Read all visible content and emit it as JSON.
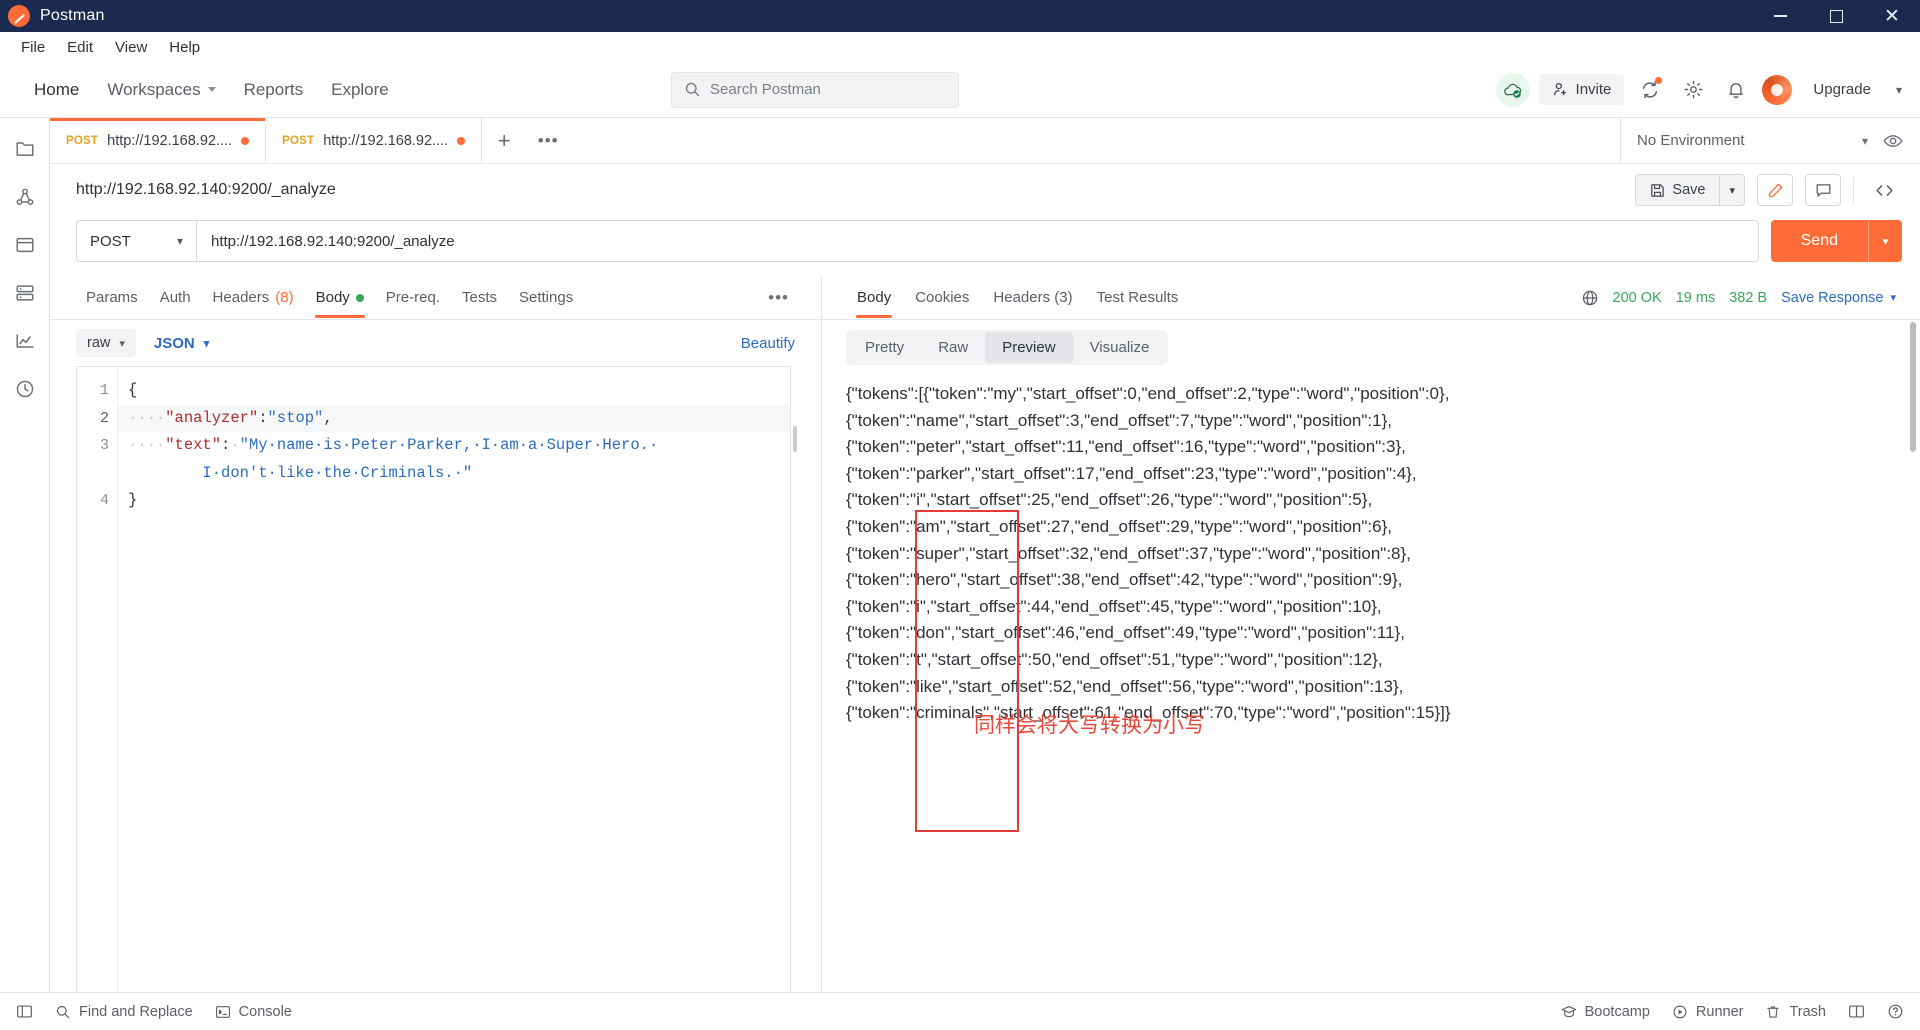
{
  "titlebar": {
    "app_name": "Postman",
    "minimize": "minimize-icon",
    "maximize": "maximize-icon",
    "close": "✕"
  },
  "menubar": {
    "items": [
      "File",
      "Edit",
      "View",
      "Help"
    ]
  },
  "navbar": {
    "items": [
      "Home",
      "Workspaces",
      "Reports",
      "Explore"
    ],
    "search_placeholder": "Search Postman",
    "invite_label": "Invite",
    "upgrade_label": "Upgrade"
  },
  "tabs": [
    {
      "method": "POST",
      "url": "http://192.168.92....",
      "unsaved": true,
      "active": true
    },
    {
      "method": "POST",
      "url": "http://192.168.92....",
      "unsaved": true,
      "active": false
    }
  ],
  "environment": {
    "selected": "No Environment"
  },
  "request": {
    "title": "http://192.168.92.140:9200/_analyze",
    "save_label": "Save",
    "method": "POST",
    "url": "http://192.168.92.140:9200/_analyze",
    "send_label": "Send"
  },
  "request_tabs": [
    {
      "label": "Params",
      "active": false
    },
    {
      "label": "Auth",
      "active": false
    },
    {
      "label": "Headers",
      "count": "(8)",
      "active": false
    },
    {
      "label": "Body",
      "active": true,
      "dot": true
    },
    {
      "label": "Pre-req.",
      "active": false
    },
    {
      "label": "Tests",
      "active": false
    },
    {
      "label": "Settings",
      "active": false
    }
  ],
  "body_controls": {
    "mode": "raw",
    "language": "JSON",
    "beautify_label": "Beautify"
  },
  "editor": {
    "line_numbers": [
      "1",
      "2",
      "3",
      "4"
    ],
    "lines": [
      {
        "text": "{"
      },
      {
        "text": "    \"analyzer\":\"stop\","
      },
      {
        "text": "    \"text\": \"My name is Peter Parker, I am a Super Hero."
      },
      {
        "text": "        I don't like the Criminals. \""
      },
      {
        "text": "}"
      }
    ],
    "code": {
      "l1_brace": "{",
      "l2_indent": "····",
      "l2_key": "\"analyzer\"",
      "l2_colon": ":",
      "l2_val": "\"stop\"",
      "l2_comma": ",",
      "l3_indent": "····",
      "l3_key": "\"text\"",
      "l3_colon": ":",
      "l3_space": "·",
      "l3_val": "\"My·name·is·Peter·Parker,·I·am·a·Super·Hero.·",
      "l4_indent": "        ",
      "l4_val": "I·don't·like·the·Criminals.·\"",
      "l5_brace": "}"
    }
  },
  "response": {
    "tabs": [
      {
        "label": "Body",
        "active": true
      },
      {
        "label": "Cookies",
        "active": false
      },
      {
        "label": "Headers",
        "count": "(3)",
        "active": false
      },
      {
        "label": "Test Results",
        "active": false
      }
    ],
    "status": "200 OK",
    "time": "19 ms",
    "size": "382 B",
    "save_response_label": "Save Response",
    "view_tabs": [
      {
        "label": "Pretty",
        "active": false
      },
      {
        "label": "Raw",
        "active": false
      },
      {
        "label": "Preview",
        "active": true
      },
      {
        "label": "Visualize",
        "active": false
      }
    ],
    "body_lines": [
      "{\"tokens\":[{\"token\":\"my\",\"start_offset\":0,\"end_offset\":2,\"type\":\"word\",\"position\":0},",
      "{\"token\":\"name\",\"start_offset\":3,\"end_offset\":7,\"type\":\"word\",\"position\":1},",
      "{\"token\":\"peter\",\"start_offset\":11,\"end_offset\":16,\"type\":\"word\",\"position\":3},",
      "{\"token\":\"parker\",\"start_offset\":17,\"end_offset\":23,\"type\":\"word\",\"position\":4},",
      "{\"token\":\"i\",\"start_offset\":25,\"end_offset\":26,\"type\":\"word\",\"position\":5},",
      "{\"token\":\"am\",\"start_offset\":27,\"end_offset\":29,\"type\":\"word\",\"position\":6},",
      "{\"token\":\"super\",\"start_offset\":32,\"end_offset\":37,\"type\":\"word\",\"position\":8},",
      "{\"token\":\"hero\",\"start_offset\":38,\"end_offset\":42,\"type\":\"word\",\"position\":9},",
      "{\"token\":\"i\",\"start_offset\":44,\"end_offset\":45,\"type\":\"word\",\"position\":10},",
      "{\"token\":\"don\",\"start_offset\":46,\"end_offset\":49,\"type\":\"word\",\"position\":11},",
      "{\"token\":\"t\",\"start_offset\":50,\"end_offset\":51,\"type\":\"word\",\"position\":12},",
      "{\"token\":\"like\",\"start_offset\":52,\"end_offset\":56,\"type\":\"word\",\"position\":13},",
      "{\"token\":\"criminals\",\"start_offset\":61,\"end_offset\":70,\"type\":\"word\",\"position\":15}]}"
    ],
    "annotation_text": "同样会将大写转换为小写"
  },
  "statusbar": {
    "find_replace": "Find and Replace",
    "console": "Console",
    "bootcamp": "Bootcamp",
    "runner": "Runner",
    "trash": "Trash"
  }
}
